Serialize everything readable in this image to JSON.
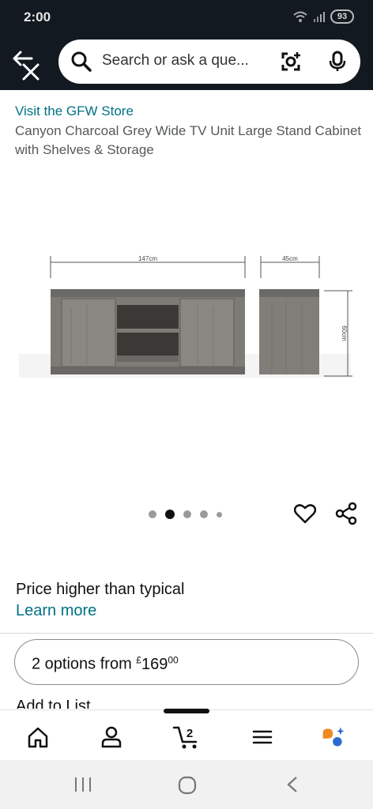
{
  "status_bar": {
    "time": "2:00",
    "battery": "93"
  },
  "search": {
    "placeholder": "Search or ask a que..."
  },
  "product": {
    "store_link": "Visit the GFW Store",
    "title": "Canyon Charcoal Grey Wide TV Unit Large Stand Cabinet with Shelves & Storage"
  },
  "image": {
    "width_label": "147cm",
    "depth_label": "45cm",
    "height_label": "60cm",
    "carousel_count": 5,
    "carousel_active": 1
  },
  "pricing": {
    "note": "Price higher than typical",
    "learn_more": "Learn more",
    "options_text": "2 options from ",
    "currency": "£",
    "price_whole": "169",
    "price_fraction": "00"
  },
  "actions": {
    "add_to_list": "Add to List"
  },
  "bottom_nav": {
    "cart_count": "2"
  },
  "colors": {
    "header_bg": "#131921",
    "link": "#007185",
    "text": "#0f1111"
  }
}
